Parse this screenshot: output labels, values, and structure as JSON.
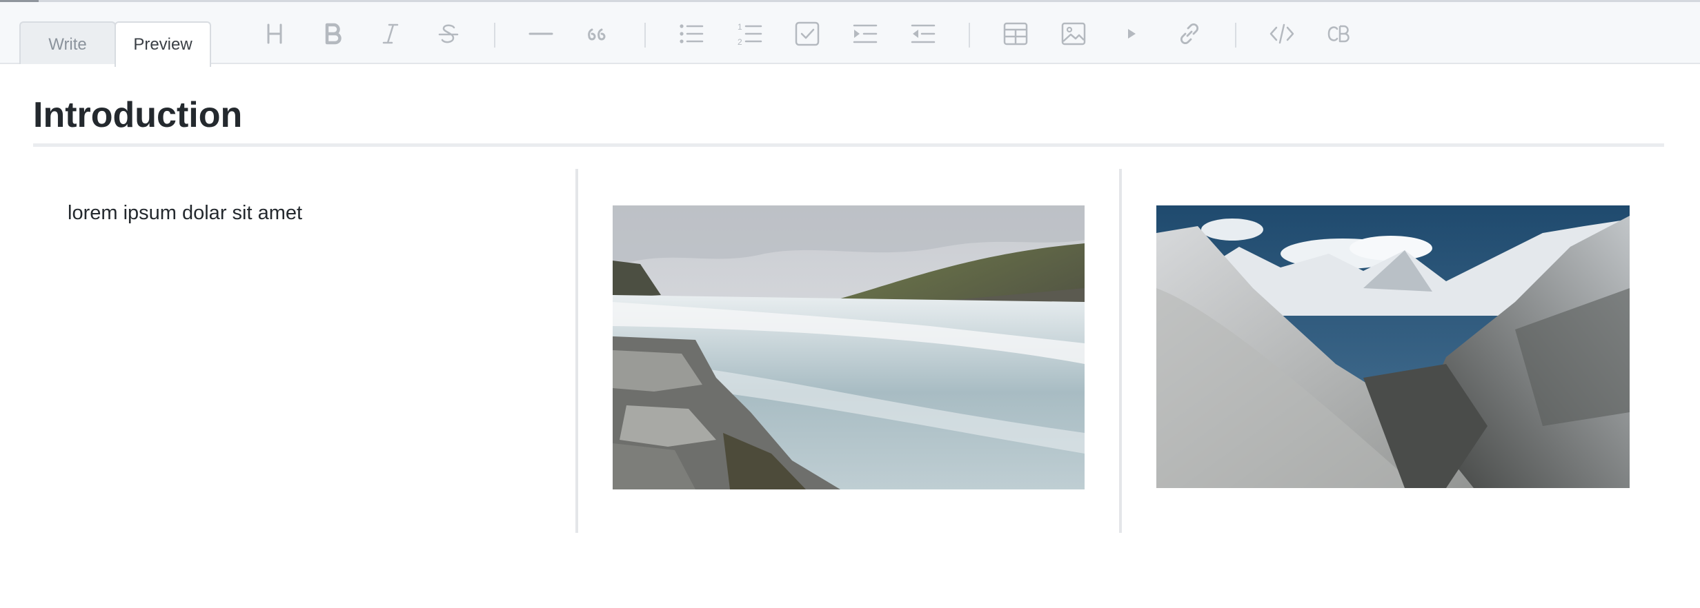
{
  "tabs": {
    "write_label": "Write",
    "preview_label": "Preview"
  },
  "toolbar": {
    "tools": [
      {
        "icon": "heading-icon",
        "glyph": "H"
      },
      {
        "icon": "bold-icon",
        "glyph": "B"
      },
      {
        "icon": "italic-icon",
        "glyph": "I"
      },
      {
        "icon": "strikethrough-icon",
        "glyph": "S"
      },
      {
        "icon": "horizontal-rule-icon"
      },
      {
        "icon": "quote-icon",
        "glyph": "66"
      },
      {
        "icon": "bulleted-list-icon"
      },
      {
        "icon": "numbered-list-icon",
        "glyph": "1 2"
      },
      {
        "icon": "checklist-icon"
      },
      {
        "icon": "indent-icon"
      },
      {
        "icon": "outdent-icon"
      },
      {
        "icon": "table-icon"
      },
      {
        "icon": "image-icon"
      },
      {
        "icon": "video-play-icon"
      },
      {
        "icon": "link-icon"
      },
      {
        "icon": "code-icon"
      },
      {
        "icon": "code-block-icon",
        "glyph": "CB"
      }
    ],
    "icon_color": "#b4b9bf"
  },
  "document": {
    "heading": "Introduction",
    "paragraph": "lorem ipsum dolar sit amet",
    "images": [
      {
        "description": "waterfall",
        "icon": "waterfall-photo"
      },
      {
        "description": "snowy mountains",
        "icon": "mountain-photo"
      }
    ]
  }
}
